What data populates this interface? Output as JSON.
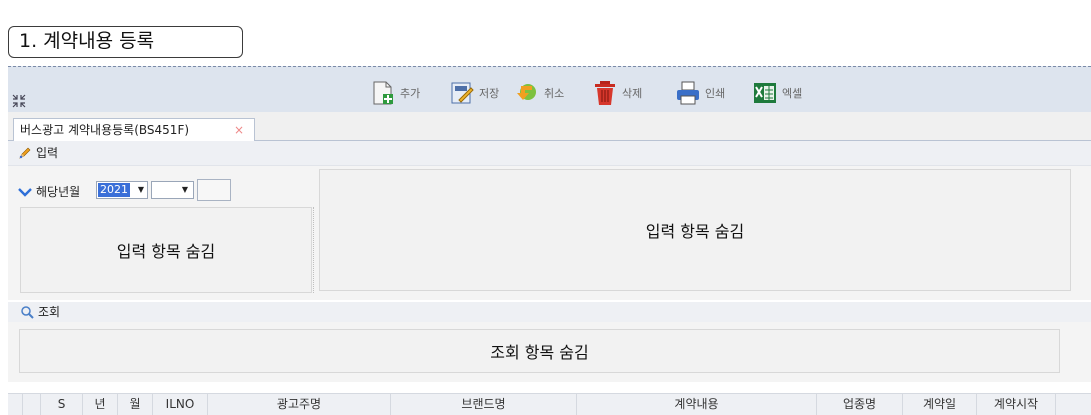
{
  "section_title": "1. 계약내용 등록",
  "toolbar": {
    "add_label": "추가",
    "save_label": "저장",
    "cancel_label": "취소",
    "delete_label": "삭제",
    "print_label": "인쇄",
    "excel_label": "엑셀"
  },
  "tab": {
    "label": "버스광고 계약내용등록(BS451F)",
    "close": "×"
  },
  "input_section": {
    "header": "입력",
    "month_label": "해당년월",
    "year_value": "2021",
    "left_panel_text": "입력 항목 숨김",
    "right_panel_text": "입력 항목 숨김"
  },
  "query_section": {
    "header": "조회",
    "panel_text": "조회 항목 숨김"
  },
  "grid": {
    "columns": [
      "S",
      "년",
      "월",
      "ILNO",
      "광고주명",
      "브랜드명",
      "계약내용",
      "업종명",
      "계약일",
      "계약시작"
    ]
  },
  "colors": {
    "toolbar_bg": "#dde4ee",
    "accent_blue": "#3a6fd8",
    "panel_bg": "#f2f2f2"
  }
}
